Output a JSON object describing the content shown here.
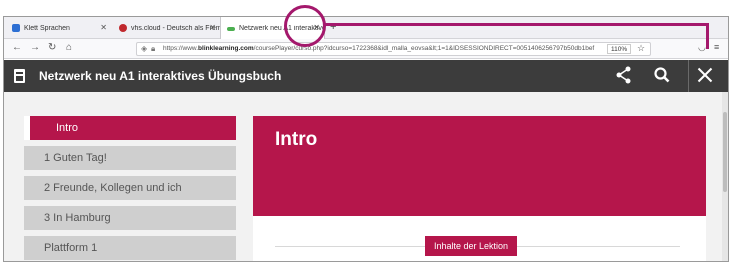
{
  "browser": {
    "tabs": [
      {
        "label": "Klett Sprachen",
        "color": "#2d6fd3"
      },
      {
        "label": "vhs.cloud - Deutsch als Fremdsp...",
        "color": "#c0282d"
      },
      {
        "label": "Netzwerk neu A1 interaktives Ü...",
        "color": "#4caf50"
      }
    ],
    "new_tab_label": "+",
    "url_prefix": "https://www.",
    "url_domain": "blinklearning.com",
    "url_rest": "/coursePlayer/curso.php?idcurso=1722368&idl_malla_eovsa&lt;1=1&IDSESSIONDIRECT=0051406256797b50db1bef",
    "zoom": "110%"
  },
  "app": {
    "title": "Netzwerk neu A1 interaktives Übungsbuch"
  },
  "sidebar": {
    "items": [
      {
        "label": "Intro",
        "active": true
      },
      {
        "label": "1 Guten Tag!",
        "active": false
      },
      {
        "label": "2 Freunde, Kollegen und ich",
        "active": false
      },
      {
        "label": "3 In Hamburg",
        "active": false
      },
      {
        "label": "Plattform 1",
        "active": false
      }
    ]
  },
  "main": {
    "title": "Intro",
    "lesson_button": "Inhalte der Lektion"
  },
  "colors": {
    "accent": "#b5164b",
    "appbar": "#3c3c3c",
    "annotation": "#a4186c"
  }
}
